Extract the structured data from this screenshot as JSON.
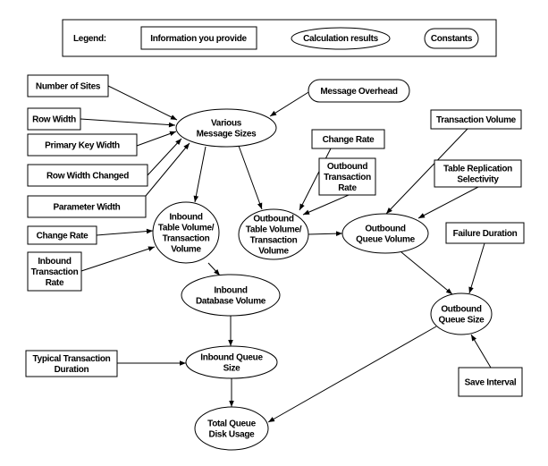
{
  "legend": {
    "title": "Legend:",
    "provide": "Information you provide",
    "calc": "Calculation results",
    "constants": "Constants"
  },
  "nodes": {
    "number_of_sites": {
      "type": "input",
      "lines": [
        "Number of Sites"
      ]
    },
    "row_width": {
      "type": "input",
      "lines": [
        "Row Width"
      ]
    },
    "primary_key_width": {
      "type": "input",
      "lines": [
        "Primary Key Width"
      ]
    },
    "row_width_changed": {
      "type": "input",
      "lines": [
        "Row Width Changed"
      ]
    },
    "parameter_width": {
      "type": "input",
      "lines": [
        "Parameter Width"
      ]
    },
    "change_rate_in": {
      "type": "input",
      "lines": [
        "Change Rate"
      ]
    },
    "inbound_transaction_rate": {
      "type": "input",
      "lines": [
        "Inbound",
        "Transaction",
        "Rate"
      ]
    },
    "message_overhead": {
      "type": "constant",
      "lines": [
        "Message Overhead"
      ]
    },
    "various_message_sizes": {
      "type": "calc",
      "lines": [
        "Various",
        "Message Sizes"
      ]
    },
    "change_rate_out": {
      "type": "input",
      "lines": [
        "Change Rate"
      ]
    },
    "outbound_transaction_rate": {
      "type": "input",
      "lines": [
        "Outbound",
        "Transaction",
        "Rate"
      ]
    },
    "transaction_volume": {
      "type": "input",
      "lines": [
        "Transaction Volume"
      ]
    },
    "table_replication_selectivity": {
      "type": "input",
      "lines": [
        "Table Replication",
        "Selectivity"
      ]
    },
    "inbound_table_volume": {
      "type": "calc",
      "lines": [
        "Inbound",
        "Table Volume/",
        "Transaction",
        "Volume"
      ]
    },
    "outbound_table_volume": {
      "type": "calc",
      "lines": [
        "Outbound",
        "Table Volume/",
        "Transaction",
        "Volume"
      ]
    },
    "outbound_queue_volume": {
      "type": "calc",
      "lines": [
        "Outbound",
        "Queue Volume"
      ]
    },
    "failure_duration": {
      "type": "input",
      "lines": [
        "Failure Duration"
      ]
    },
    "inbound_database_volume": {
      "type": "calc",
      "lines": [
        "Inbound",
        "Database Volume"
      ]
    },
    "outbound_queue_size": {
      "type": "calc",
      "lines": [
        "Outbound",
        "Queue Size"
      ]
    },
    "typical_transaction_duration": {
      "type": "input",
      "lines": [
        "Typical Transaction",
        "Duration"
      ]
    },
    "inbound_queue_size": {
      "type": "calc",
      "lines": [
        "Inbound Queue",
        "Size"
      ]
    },
    "save_interval": {
      "type": "input",
      "lines": [
        "Save Interval"
      ]
    },
    "total_queue_disk_usage": {
      "type": "calc",
      "lines": [
        "Total Queue",
        "Disk Usage"
      ]
    }
  },
  "edges": [
    [
      "number_of_sites",
      "various_message_sizes"
    ],
    [
      "row_width",
      "various_message_sizes"
    ],
    [
      "primary_key_width",
      "various_message_sizes"
    ],
    [
      "row_width_changed",
      "various_message_sizes"
    ],
    [
      "parameter_width",
      "various_message_sizes"
    ],
    [
      "message_overhead",
      "various_message_sizes"
    ],
    [
      "various_message_sizes",
      "inbound_table_volume"
    ],
    [
      "various_message_sizes",
      "outbound_table_volume"
    ],
    [
      "change_rate_in",
      "inbound_table_volume"
    ],
    [
      "inbound_transaction_rate",
      "inbound_table_volume"
    ],
    [
      "change_rate_out",
      "outbound_table_volume"
    ],
    [
      "outbound_transaction_rate",
      "outbound_table_volume"
    ],
    [
      "outbound_table_volume",
      "outbound_queue_volume"
    ],
    [
      "transaction_volume",
      "outbound_queue_volume"
    ],
    [
      "table_replication_selectivity",
      "outbound_queue_volume"
    ],
    [
      "outbound_queue_volume",
      "outbound_queue_size"
    ],
    [
      "failure_duration",
      "outbound_queue_size"
    ],
    [
      "save_interval",
      "outbound_queue_size"
    ],
    [
      "inbound_table_volume",
      "inbound_database_volume"
    ],
    [
      "inbound_database_volume",
      "inbound_queue_size"
    ],
    [
      "typical_transaction_duration",
      "inbound_queue_size"
    ],
    [
      "inbound_queue_size",
      "total_queue_disk_usage"
    ],
    [
      "outbound_queue_size",
      "total_queue_disk_usage"
    ]
  ]
}
